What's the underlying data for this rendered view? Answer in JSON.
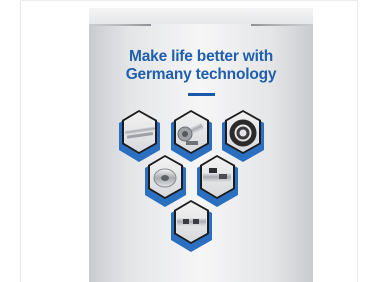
{
  "banner": {
    "headline_line1": "Make life better with",
    "headline_line2": "Germany technology",
    "accent_color": "#1f5fae"
  },
  "products": [
    {
      "name": "aluminium-rail-icon"
    },
    {
      "name": "motor-icon"
    },
    {
      "name": "toothed-belt-icon"
    },
    {
      "name": "pulley-icon"
    },
    {
      "name": "control-unit-icon"
    },
    {
      "name": "drive-assembly-icon"
    }
  ]
}
